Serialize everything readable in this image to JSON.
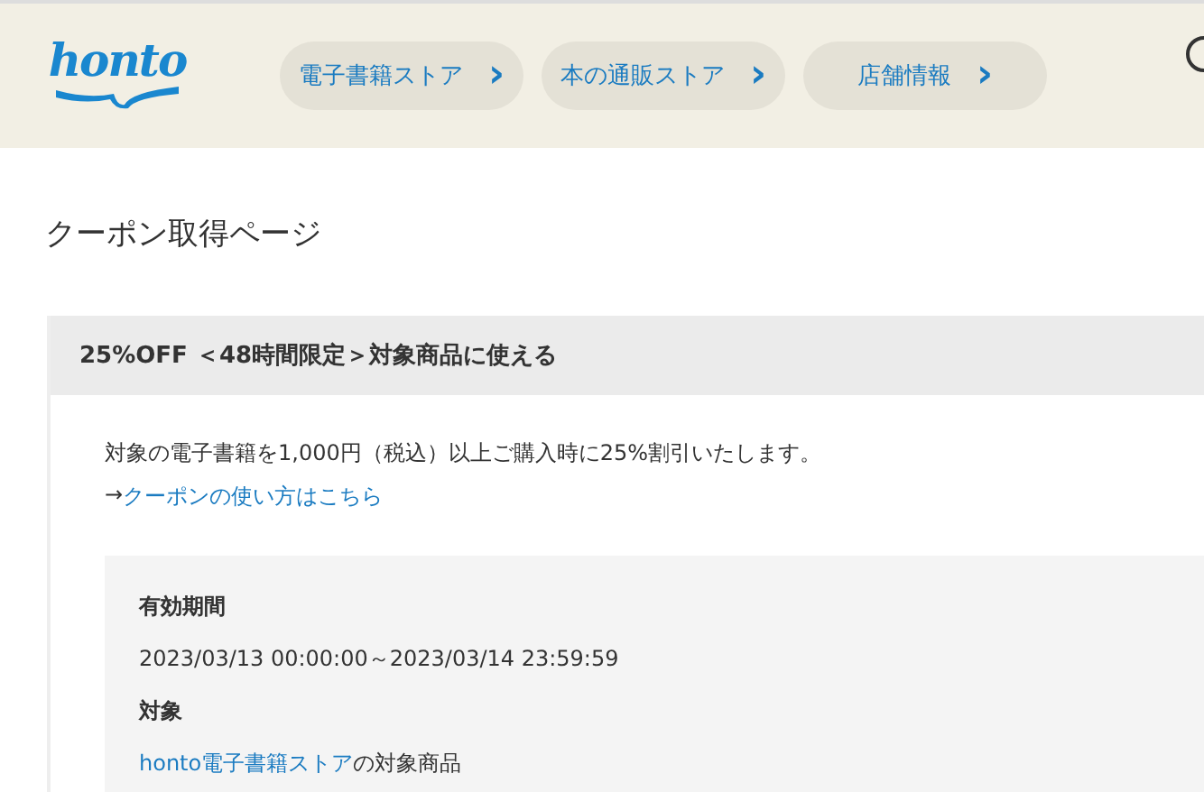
{
  "header": {
    "logo": "honto",
    "nav": [
      {
        "label": "電子書籍ストア",
        "icon": "›"
      },
      {
        "label": "本の通販ストア",
        "icon": "›"
      },
      {
        "label": "店舗情報",
        "icon": "›"
      }
    ]
  },
  "page_title": "クーポン取得ページ",
  "coupon": {
    "title": "25%OFF ＜48時間限定＞対象商品に使える",
    "description": "対象の電子書籍を1,000円（税込）以上ご購入時に25%割引いたします。",
    "help_prefix": "→",
    "help_link": "クーポンの使い方はこちら",
    "details": [
      {
        "label": "有効期間",
        "value": "2023/03/13 00:00:00～2023/03/14 23:59:59"
      },
      {
        "label": "対象",
        "link": "honto電子書籍ストア",
        "value": "の対象商品"
      }
    ]
  }
}
